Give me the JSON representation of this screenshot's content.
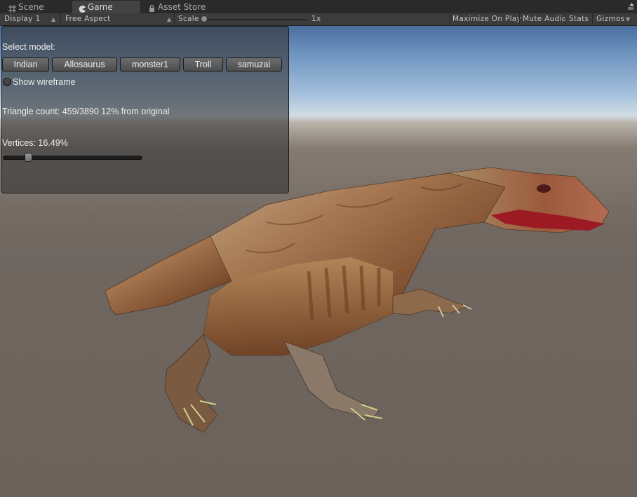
{
  "tabs": [
    {
      "label": "Scene",
      "icon": "grid-icon"
    },
    {
      "label": "Game",
      "icon": "pacman-icon",
      "active": true
    },
    {
      "label": "Asset Store",
      "icon": "lock-icon"
    }
  ],
  "toolbar": {
    "display": "Display 1",
    "aspect": "Free Aspect",
    "scale_label": "Scale",
    "scale_value": "1x",
    "maximize": "Maximize On Play",
    "mute": "Mute Audio",
    "stats": "Stats",
    "gizmos": "Gizmos"
  },
  "gui": {
    "select_label": "Select model:",
    "models": [
      "Indian",
      "Allosaurus",
      "monster1",
      "Troll",
      "samuzai"
    ],
    "wireframe_label": "Show wireframe",
    "triangle_text": "Triangle count: 459/3890 12% from original",
    "vertices_text": "Vertices: 16.49%",
    "vertices_fraction": 0.1649
  }
}
